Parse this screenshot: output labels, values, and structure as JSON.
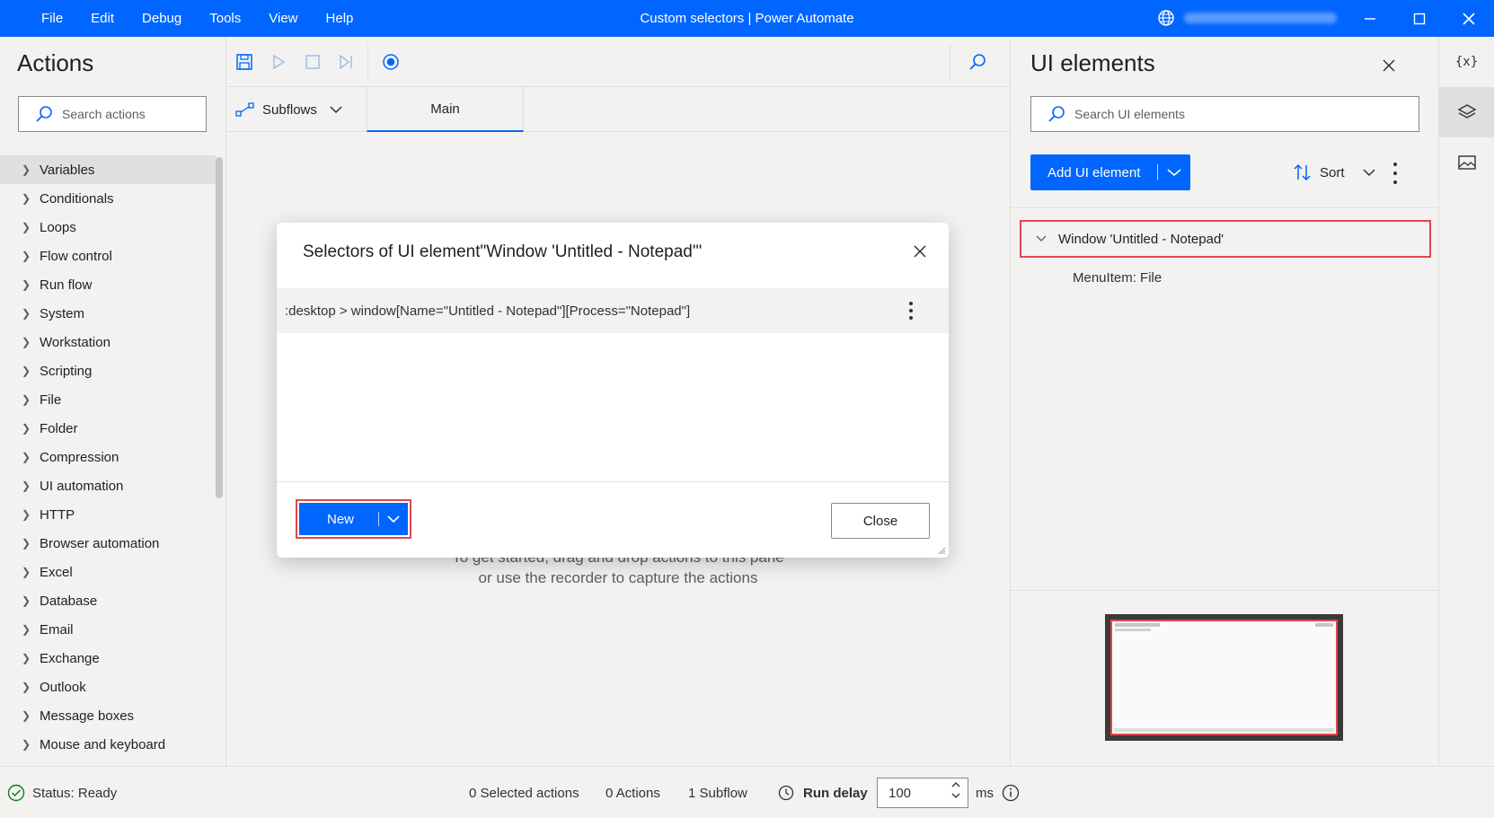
{
  "titlebar": {
    "menu": [
      "File",
      "Edit",
      "Debug",
      "Tools",
      "View",
      "Help"
    ],
    "title": "Custom selectors | Power Automate"
  },
  "actions_pane": {
    "title": "Actions",
    "search_placeholder": "Search actions",
    "categories": [
      "Variables",
      "Conditionals",
      "Loops",
      "Flow control",
      "Run flow",
      "System",
      "Workstation",
      "Scripting",
      "File",
      "Folder",
      "Compression",
      "UI automation",
      "HTTP",
      "Browser automation",
      "Excel",
      "Database",
      "Email",
      "Exchange",
      "Outlook",
      "Message boxes",
      "Mouse and keyboard"
    ]
  },
  "designer": {
    "subflows_label": "Subflows",
    "main_tab": "Main",
    "empty_line1": "To get started, drag and drop actions to this pane",
    "empty_line2": "or use the recorder to capture the actions"
  },
  "ui_elements": {
    "title": "UI elements",
    "search_placeholder": "Search UI elements",
    "add_label": "Add UI element",
    "sort_label": "Sort",
    "tree_item": "Window 'Untitled - Notepad'",
    "tree_child": "MenuItem: File"
  },
  "dialog": {
    "title": "Selectors of UI element\"Window 'Untitled - Notepad'\"",
    "selector": ":desktop > window[Name=\"Untitled - Notepad\"][Process=\"Notepad\"]",
    "new_label": "New",
    "close_label": "Close"
  },
  "statusbar": {
    "status": "Status: Ready",
    "selected_actions": "0 Selected actions",
    "actions": "0 Actions",
    "subflows": "1 Subflow",
    "run_delay_label": "Run delay",
    "run_delay_value": "100",
    "unit": "ms"
  },
  "colors": {
    "accent": "#0066ff",
    "highlight": "#e0474c",
    "status_ok": "#107c10"
  }
}
